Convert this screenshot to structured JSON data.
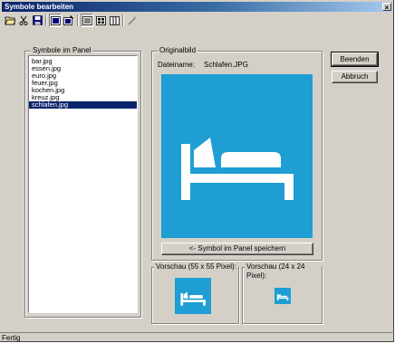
{
  "window": {
    "title": "Symbole bearbeiten",
    "close_glyph": "×"
  },
  "toolbar": {
    "icons": [
      "open-folder-icon",
      "cut-icon",
      "save-icon",
      "image-icon",
      "image-select-icon",
      "list-view-icon",
      "grid-view-icon",
      "columns-view-icon",
      "wand-icon"
    ]
  },
  "symbols_panel": {
    "label": "Symbole im Panel",
    "items": [
      "bar.jpg",
      "essen.jpg",
      "euro.jpg",
      "feuer.jpg",
      "kochen.jpg",
      "kreuz.jpg",
      "schlafen.jpg"
    ],
    "selected_index": 6
  },
  "original": {
    "label": "Originalbild",
    "filename_label": "Dateiname:",
    "filename_value": "Schlafen.JPG",
    "save_button": "<- Symbol im Panel speichern",
    "preview_color": "#1e9ed3"
  },
  "preview_55": {
    "label": "Vorschau (55 x 55  Pixel):"
  },
  "preview_24": {
    "label": "Vorschau (24 x 24 Pixel):"
  },
  "buttons": {
    "close": "Beenden",
    "cancel": "Abbruch"
  },
  "status": {
    "text": "Fertig"
  }
}
